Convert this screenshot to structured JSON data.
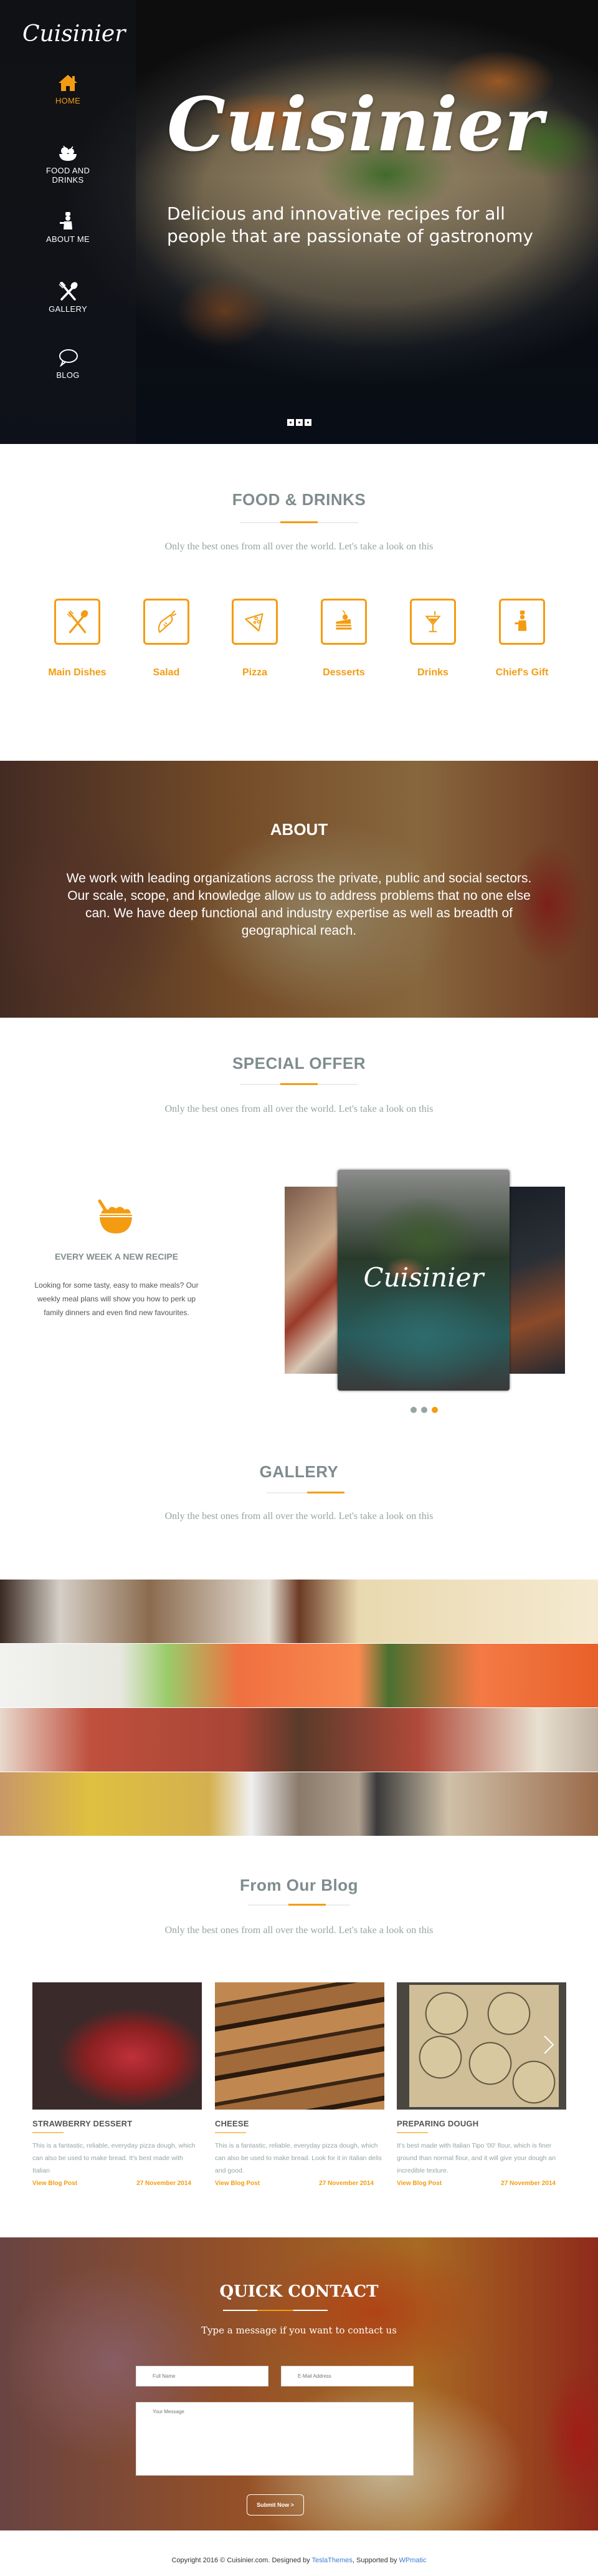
{
  "brand": {
    "name": "Cuisinier",
    "accent": "#f39c12"
  },
  "sidebar": {
    "logo": "Cuisinier",
    "items": [
      {
        "label": "HOME",
        "icon": "home-icon",
        "active": true
      },
      {
        "label": "FOOD AND DRINKS",
        "icon": "fruit-basket-icon",
        "active": false
      },
      {
        "label": "ABOUT ME",
        "icon": "chef-icon",
        "active": false
      },
      {
        "label": "GALLERY",
        "icon": "fork-spoon-icon",
        "active": false
      },
      {
        "label": "BLOG",
        "icon": "speech-bubble-icon",
        "active": false
      }
    ]
  },
  "hero": {
    "title": "Cuisinier",
    "tagline": "Delicious and innovative recipes for all people that are passionate of gastronomy",
    "slides_count": 3
  },
  "food_drinks": {
    "title": "FOOD & DRINKS",
    "subtitle": "Only the best ones from all over the world. Let's take a look on this",
    "categories": [
      {
        "label": "Main Dishes",
        "icon": "fork-spoon-icon"
      },
      {
        "label": "Salad",
        "icon": "carrot-icon"
      },
      {
        "label": "Pizza",
        "icon": "pizza-slice-icon"
      },
      {
        "label": "Desserts",
        "icon": "cake-icon"
      },
      {
        "label": "Drinks",
        "icon": "cocktail-icon"
      },
      {
        "label": "Chief's Gift",
        "icon": "chef-icon"
      }
    ]
  },
  "about": {
    "title": "ABOUT",
    "text": "We work with leading organizations across the private, public and social sectors. Our scale, scope, and knowledge allow us to address problems that no one else can. We have deep functional and industry expertise as well as breadth of geographical reach."
  },
  "special_offer": {
    "title": "SPECIAL OFFER",
    "subtitle": "Only the best ones from all over the world. Let's take a look on this",
    "feature_heading": "EVERY WEEK A NEW RECIPE",
    "feature_text": "Looking for some tasty, easy to make meals? Our weekly meal plans will show you how to perk up family dinners and even find new favourites.",
    "slide_logo": "Cuisinier",
    "dots_count": 3,
    "active_dot": 3
  },
  "gallery": {
    "title": "GALLERY",
    "subtitle": "Only the best ones from all over the world. Let's take a look on this",
    "strips_count": 4
  },
  "blog": {
    "title": "From Our Blog",
    "subtitle": "Only the best ones from all over the world. Let's take a look on this",
    "posts": [
      {
        "title": "STRAWBERRY DESSERT",
        "text": "This is a fantastic, reliable, everyday pizza dough, which can also be used to make bread. It's best made with Italian",
        "link": "View Blog Post",
        "date": "27 November 2014"
      },
      {
        "title": "CHEESE",
        "text": "This is a fantastic, reliable, everyday pizza dough, which can also be used to make bread. Look for it in Italian delis and good.",
        "link": "View Blog Post",
        "date": "27 November 2014"
      },
      {
        "title": "PREPARING DOUGH",
        "text": "It's best made with Italian Tipo '00' flour, which is finer ground than normal flour, and it will give your dough an incredible texture.",
        "link": "View Blog Post",
        "date": "27 November 2014"
      }
    ]
  },
  "contact": {
    "title": "QUICK CONTACT",
    "subtitle": "Type a message if you want to contact us",
    "name_placeholder": "Full Name",
    "email_placeholder": "E-Mail Address",
    "message_placeholder": "Your Message",
    "name_value": "",
    "email_value": "",
    "message_value": "",
    "submit_label": "Submit Now >"
  },
  "footer": {
    "prefix": "Copyright 2016 © Cuisinier.com. Designed by ",
    "designer": "TeslaThemes",
    "middle": ", Supported by ",
    "supporter": "WPmatic"
  }
}
